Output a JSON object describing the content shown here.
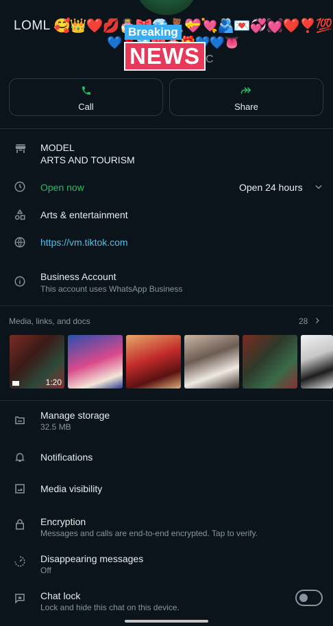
{
  "header": {
    "name": "LOML",
    "emojis_line1": "🥰👑❤️💋🎂🎀💎🧸💝💘🫂💌💞💓❤️❣️💯",
    "emojis_line2": "💙🌹💎🎀🎂🎁💙💙👅",
    "subtitle_peek": "C",
    "breaking_label": "Breaking",
    "news_label": "NEWS"
  },
  "actions": {
    "call_label": "Call",
    "share_label": "Share"
  },
  "business": {
    "category_line1": "MODEL",
    "category_line2": "ARTS AND TOURISM",
    "status": "Open now",
    "hours": "Open 24 hours",
    "category": "Arts & entertainment",
    "website": "https://vm.tiktok.com",
    "account_title": "Business Account",
    "account_sub": "This account uses WhatsApp Business"
  },
  "media": {
    "header": "Media, links, and docs",
    "count": "28",
    "video_duration": "1:20"
  },
  "settings": [
    {
      "title": "Manage storage",
      "sub": "32.5 MB",
      "icon": "storage-icon"
    },
    {
      "title": "Notifications",
      "sub": "",
      "icon": "bell-icon"
    },
    {
      "title": "Media visibility",
      "sub": "",
      "icon": "image-icon"
    },
    {
      "title": "Encryption",
      "sub": "Messages and calls are end-to-end encrypted. Tap to verify.",
      "icon": "lock-icon"
    },
    {
      "title": "Disappearing messages",
      "sub": "Off",
      "icon": "timer-icon"
    },
    {
      "title": "Chat lock",
      "sub": "Lock and hide this chat on this device.",
      "icon": "chat-lock-icon"
    }
  ],
  "chat_lock_enabled": false,
  "colors": {
    "background": "#0b141a",
    "accent_green": "#21c063",
    "link_blue": "#53bdeb",
    "breaking_blue": "#39aef0",
    "news_red": "#e8395b"
  }
}
